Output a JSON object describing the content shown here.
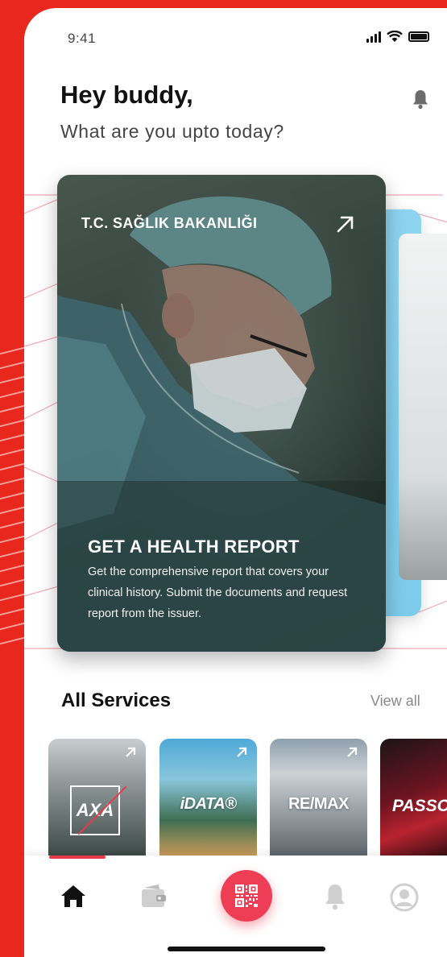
{
  "status_bar": {
    "time": "9:41"
  },
  "header": {
    "greeting": "Hey buddy,",
    "subtitle": "What are you upto today?"
  },
  "featured_card": {
    "issuer": "T.C. SAĞLIK BAKANLIĞI",
    "title": "GET A HEALTH REPORT",
    "description": "Get the comprehensive report that covers your clinical history. Submit the documents and request report from the issuer."
  },
  "services": {
    "title": "All Services",
    "view_all": "View all",
    "items": [
      {
        "logo": "AXA"
      },
      {
        "logo": "iDATA®"
      },
      {
        "logo": "RE/MAX"
      },
      {
        "logo": "PASSO"
      }
    ]
  },
  "tabbar": {
    "active": "home",
    "items": [
      "home-icon",
      "wallet-icon",
      "qr-code-icon",
      "bell-icon",
      "profile-icon"
    ]
  },
  "colors": {
    "accent": "#ee3e55",
    "background": "#e8281d",
    "text": "#111111"
  }
}
